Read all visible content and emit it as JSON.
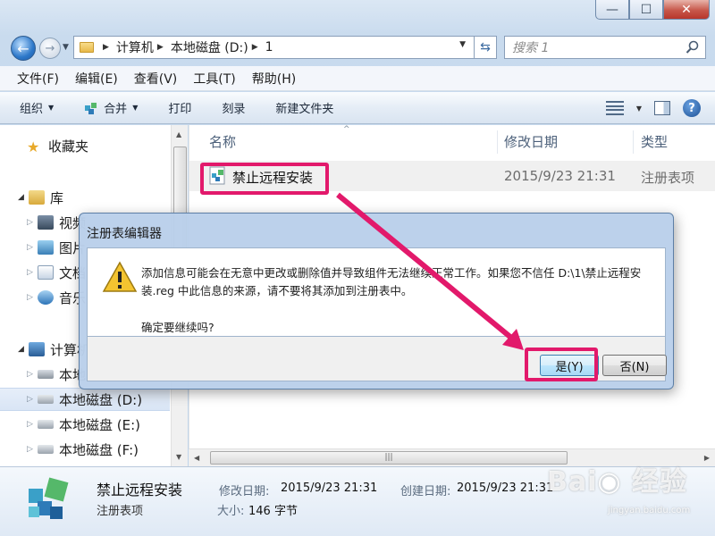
{
  "window": {
    "caption_min": "—",
    "caption_max": "☐",
    "caption_close": "✕"
  },
  "navbar": {
    "breadcrumb": [
      "计算机",
      "本地磁盘 (D:)",
      "1"
    ],
    "search_placeholder": "搜索 1"
  },
  "menubar": {
    "items": [
      "文件(F)",
      "编辑(E)",
      "查看(V)",
      "工具(T)",
      "帮助(H)"
    ]
  },
  "commandbar": {
    "organize": "组织",
    "merge": "合并",
    "burn": "打印",
    "record": "刻录",
    "new_folder": "新建文件夹"
  },
  "navpane": {
    "favorites": "收藏夹",
    "library": "库",
    "videos": "视频",
    "pictures": "图片",
    "documents": "文档",
    "music": "音乐",
    "computer": "计算机",
    "drive_c": "本地",
    "drive_d": "本地磁盘 (D:)",
    "drive_e": "本地磁盘 (E:)",
    "drive_f": "本地磁盘 (F:)"
  },
  "filelist": {
    "columns": [
      "名称",
      "修改日期",
      "类型"
    ],
    "rows": [
      {
        "name": "禁止远程安装",
        "modified": "2015/9/23 21:31",
        "type": "注册表项"
      }
    ]
  },
  "details": {
    "name": "禁止远程安装",
    "type": "注册表项",
    "modified_label": "修改日期:",
    "modified_value": "2015/9/23 21:31",
    "created_label": "创建日期:",
    "created_value": "2015/9/23 21:31",
    "size_label": "大小:",
    "size_value": "146 字节"
  },
  "dialog": {
    "title": "注册表编辑器",
    "message": "添加信息可能会在无意中更改或删除值并导致组件无法继续正常工作。如果您不信任 D:\\1\\禁止远程安装.reg 中此信息的来源，请不要将其添加到注册表中。",
    "question": "确定要继续吗?",
    "yes": "是(Y)",
    "no": "否(N)"
  },
  "watermark": {
    "brand": "Bai 经验",
    "url": "jingyan.baidu.com"
  },
  "colors": {
    "highlight": "#e2196b",
    "window_chrome": "#c9dbee"
  }
}
